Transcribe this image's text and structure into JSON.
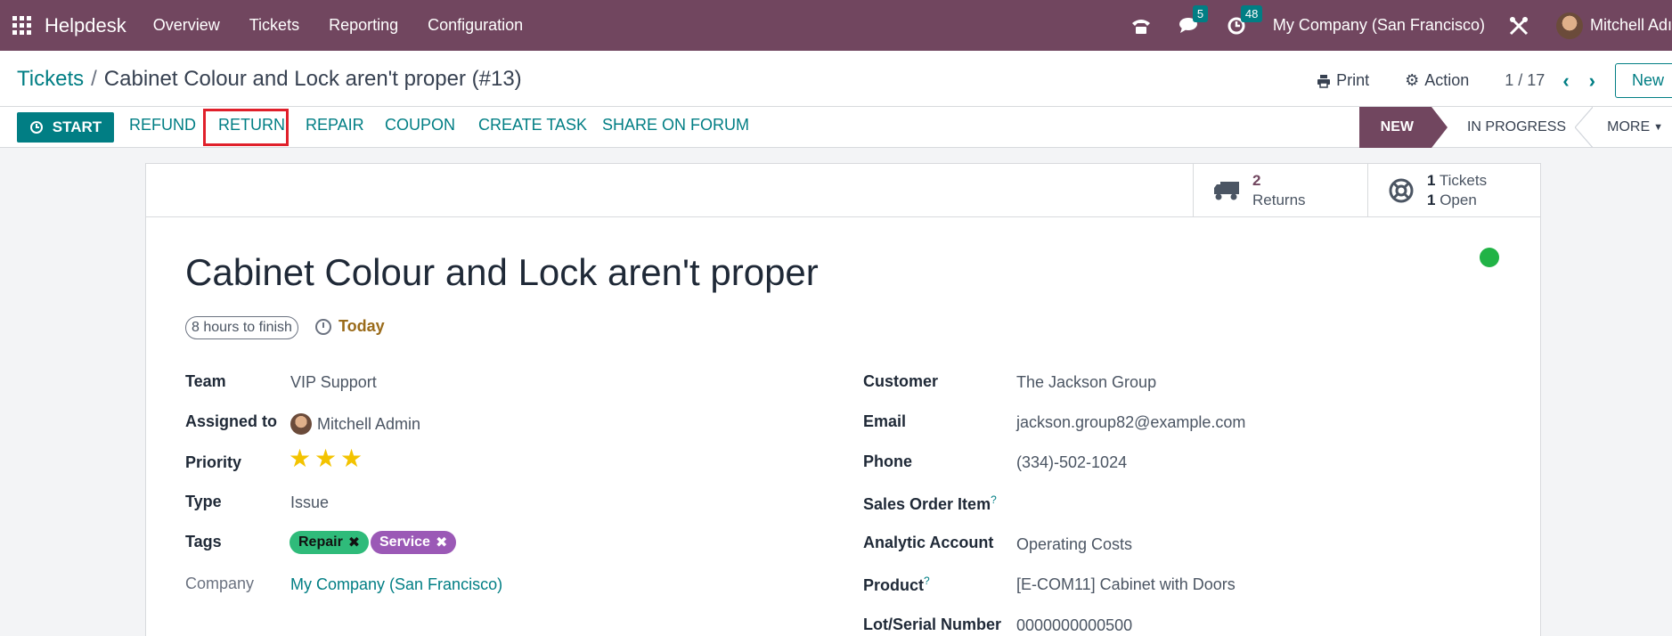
{
  "navbar": {
    "brand": "Helpdesk",
    "menu": [
      "Overview",
      "Tickets",
      "Reporting",
      "Configuration"
    ],
    "messages_count": "5",
    "activities_count": "48",
    "company": "My Company (San Francisco)",
    "user": "Mitchell Adı"
  },
  "control": {
    "breadcrumb_parent": "Tickets",
    "breadcrumb_sep": "/",
    "breadcrumb_current": "Cabinet Colour and Lock aren't proper (#13)",
    "print": "Print",
    "action": "Action",
    "pager": "1 / 17",
    "new": "New"
  },
  "actions": {
    "start": "START",
    "refund": "REFUND",
    "return": "RETURN",
    "repair": "REPAIR",
    "coupon": "COUPON",
    "create_task": "CREATE TASK",
    "share": "SHARE ON FORUM"
  },
  "stages": {
    "new": "NEW",
    "in_progress": "IN PROGRESS",
    "more": "MORE"
  },
  "smart": {
    "returns_count": "2",
    "returns_label": "Returns",
    "tickets_count": "1",
    "tickets_label": "Tickets",
    "open_count": "1",
    "open_label": "Open"
  },
  "ticket": {
    "title": "Cabinet Colour and Lock aren't proper",
    "sla": "8 hours to finish",
    "deadline": "Today",
    "priority_stars": 3,
    "left": {
      "team_label": "Team",
      "team": "VIP Support",
      "assigned_label": "Assigned to",
      "assigned": "Mitchell Admin",
      "priority_label": "Priority",
      "type_label": "Type",
      "type": "Issue",
      "tags_label": "Tags",
      "tag1": "Repair",
      "tag2": "Service",
      "company_label": "Company",
      "company": "My Company (San Francisco)"
    },
    "right": {
      "customer_label": "Customer",
      "customer": "The Jackson Group",
      "email_label": "Email",
      "email": "jackson.group82@example.com",
      "phone_label": "Phone",
      "phone": "(334)-502-1024",
      "so_label": "Sales Order Item",
      "analytic_label": "Analytic Account",
      "analytic": "Operating Costs",
      "product_label": "Product",
      "product": "[E-COM11] Cabinet with Doors",
      "lot_label": "Lot/Serial Number",
      "lot": "0000000000500"
    }
  },
  "colors": {
    "brand": "#71465f",
    "accent": "#017e84",
    "highlight": "#e0202b",
    "status": "#21b346"
  }
}
